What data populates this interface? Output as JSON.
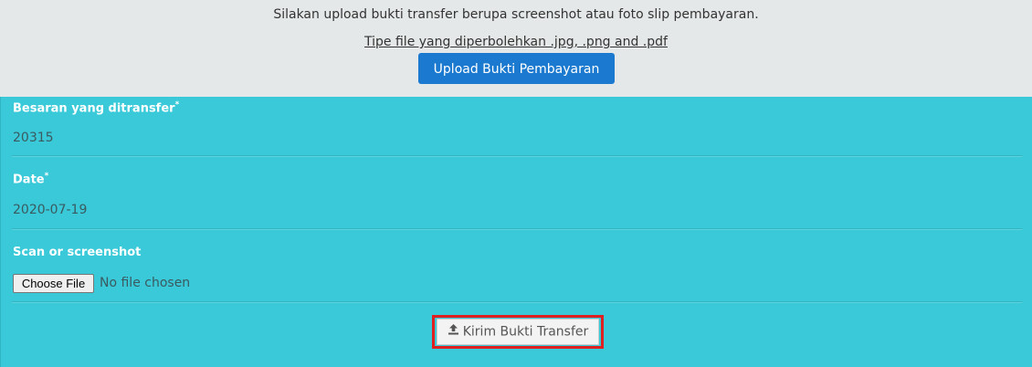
{
  "header": {
    "instructions": "Silakan upload bukti transfer berupa screenshot atau foto slip pembayaran.",
    "file_types": "Tipe file yang diperbolehkan .jpg, .png and .pdf",
    "upload_button": "Upload Bukti Pembayaran"
  },
  "form": {
    "amount": {
      "label": "Besaran yang ditransfer",
      "required": "*",
      "value": "20315"
    },
    "date": {
      "label": "Date",
      "required": "*",
      "value": "2020-07-19"
    },
    "scan": {
      "label": "Scan or screenshot",
      "button": "Choose File",
      "status": "No file chosen"
    },
    "submit_label": "Kirim Bukti Transfer",
    "submit_icon": "upload-icon"
  },
  "colors": {
    "top_bg": "#e5e8e8",
    "panel_bg": "#3ac9d8",
    "primary_button": "#1b79cf",
    "highlight": "#e02020"
  }
}
